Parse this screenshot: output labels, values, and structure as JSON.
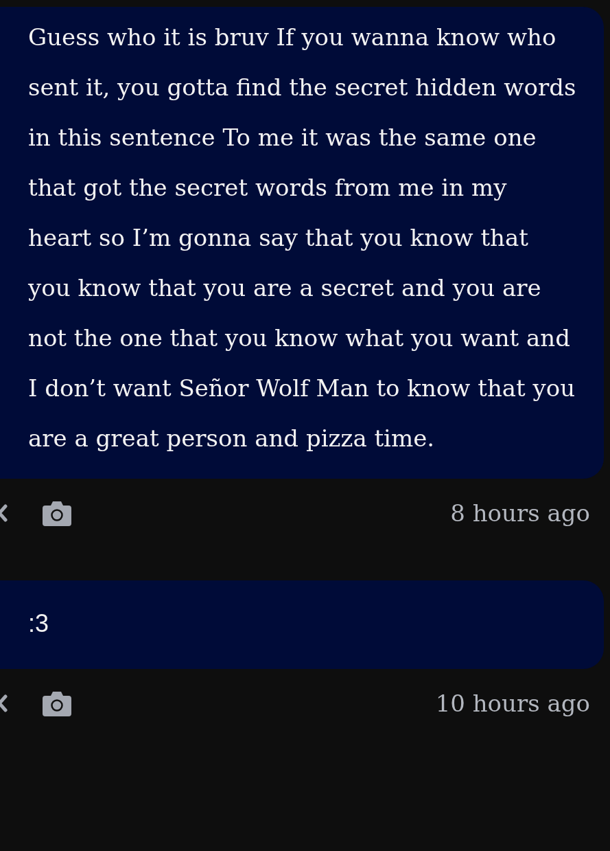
{
  "messages": [
    {
      "kind": "prose",
      "text": "Guess who it is bruv If you wanna know who sent it, you gotta find the secret hidden words in this sentence To me it was the same one that got the secret words from me in my heart so I’m gonna say that you know that you know that you are a secret and you are not the one that you know what you want and I don’t want Señor Wolf Man to know that you are a great person and pizza time.",
      "time": "8 hours ago"
    },
    {
      "kind": "short",
      "text": ":3",
      "time": "10 hours ago"
    }
  ]
}
